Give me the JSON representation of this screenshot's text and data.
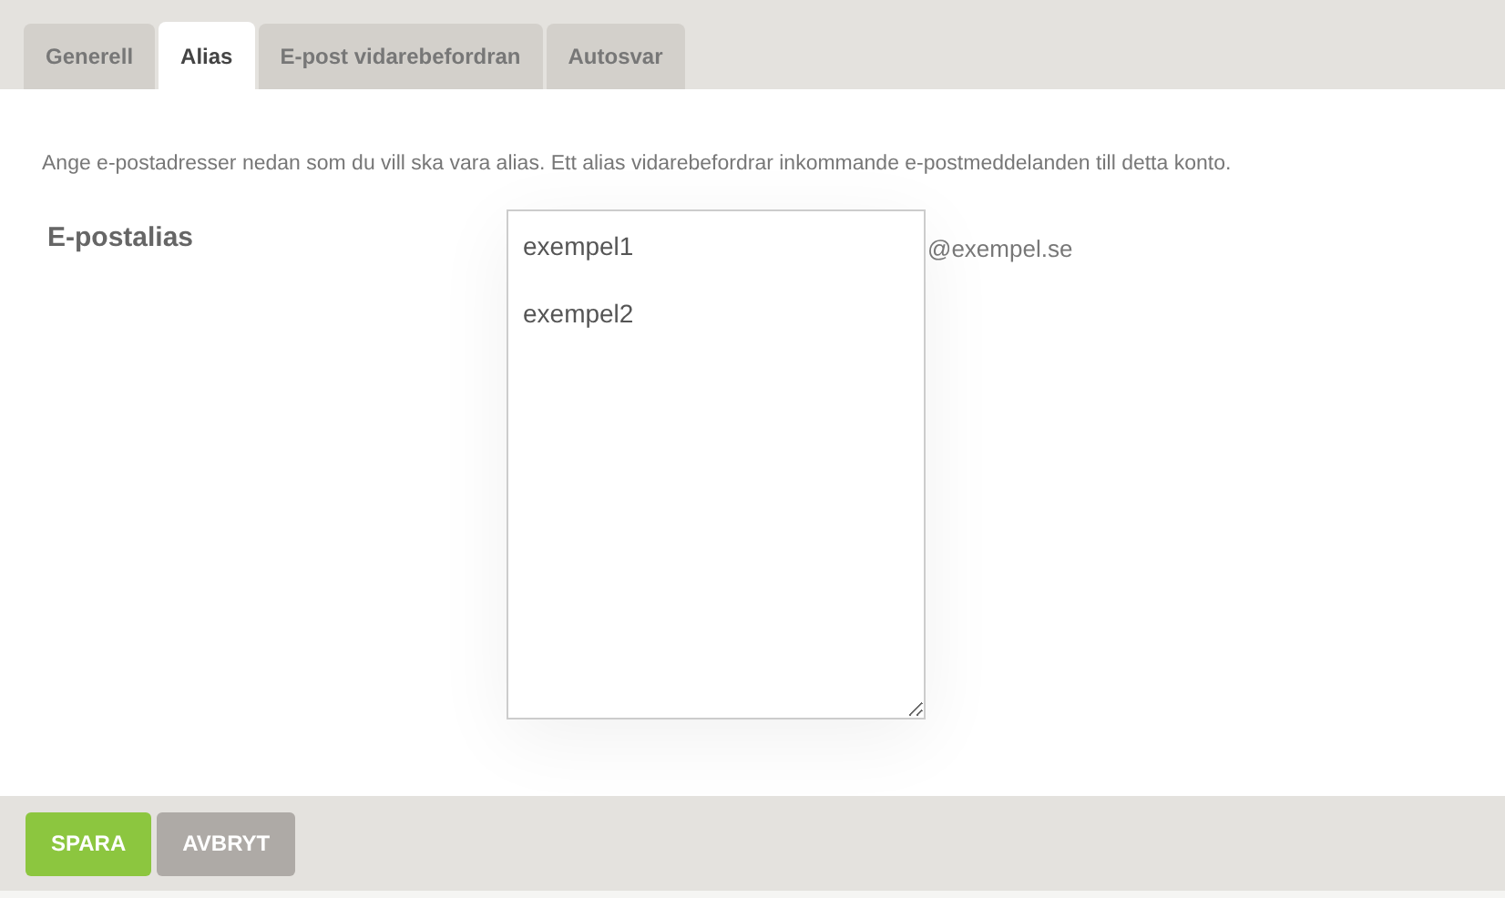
{
  "tabs": [
    {
      "label": "Generell",
      "selected": false
    },
    {
      "label": "Alias",
      "selected": true
    },
    {
      "label": "E-post vidarebefordran",
      "selected": false
    },
    {
      "label": "Autosvar",
      "selected": false
    }
  ],
  "description": "Ange e-postadresser nedan som du vill ska vara alias. Ett alias vidarebefordrar inkommande e-postmeddelanden till detta konto.",
  "alias_field": {
    "label": "E-postalias",
    "value": "exempel1\n\nexempel2",
    "suffix": "@exempel.se"
  },
  "buttons": [
    {
      "label": "SPARA",
      "kind": "primary"
    },
    {
      "label": "AVBRYT",
      "kind": "secondary"
    }
  ]
}
